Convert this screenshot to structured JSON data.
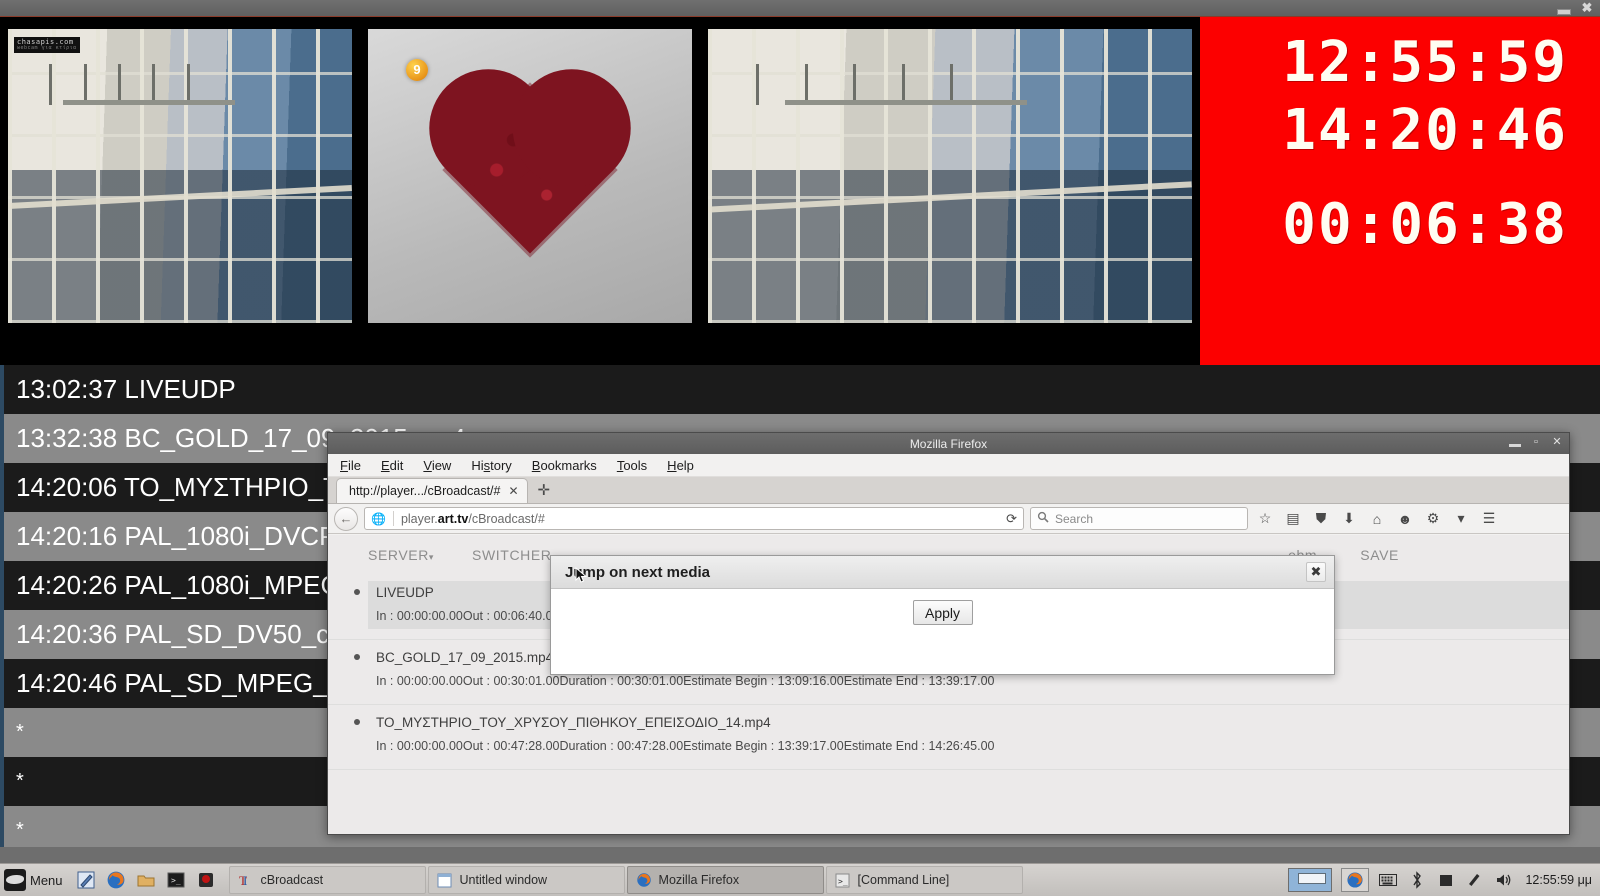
{
  "desktop": {
    "cbroadcast": {
      "window_title": "",
      "clock": {
        "line1": "12:55:59",
        "line2": "14:20:46",
        "line3": "00:06:38",
        "bg_color": "#fc0000",
        "digit_color": "#fffdf2"
      },
      "preview": {
        "left_watermark": "chasapis.com",
        "left_watermark_sub": "webcam για κτίρια",
        "mid_badge": "9"
      },
      "schedule_rows": [
        {
          "time": "13:02:37",
          "name": "LIVEUDP",
          "shade": "dark"
        },
        {
          "time": "13:32:38",
          "name": "BC_GOLD_17_09_2015.mp4",
          "shade": "light"
        },
        {
          "time": "14:20:06",
          "name": "ΤΟ_ΜΥΣΤΗΡΙΟ_ΤΟΥ_ΧΡΥΣΟΥ_ΠΙΘΗΚΟΥ_ΕΠΕΙΣΟΔΙΟ_14.mp4",
          "shade": "dark"
        },
        {
          "time": "14:20:16",
          "name": "PAL_1080i_DVCPRO_colorbars.mxf",
          "shade": "light"
        },
        {
          "time": "14:20:26",
          "name": "PAL_1080i_MPEG_XDCAM_colorbars.mxf",
          "shade": "dark"
        },
        {
          "time": "14:20:36",
          "name": "PAL_SD_DV50_colorbars.mxf",
          "shade": "light"
        },
        {
          "time": "14:20:46",
          "name": "PAL_SD_MPEG_IFrame_colorbars.mxf",
          "shade": "dark"
        },
        {
          "time": "",
          "name": "*",
          "shade": "light"
        },
        {
          "time": "",
          "name": "*",
          "shade": "dark"
        },
        {
          "time": "",
          "name": "*",
          "shade": "light"
        }
      ]
    },
    "firefox": {
      "title": "Mozilla Firefox",
      "menus": [
        "File",
        "Edit",
        "View",
        "History",
        "Bookmarks",
        "Tools",
        "Help"
      ],
      "tab": {
        "label": "http://player.../cBroadcast/#",
        "close": "✕"
      },
      "newtab_label": "✛",
      "url": {
        "prefix": "player.",
        "host": "art.tv",
        "path": "/cBroadcast/#"
      },
      "search_placeholder": "Search",
      "reload_icon": "⟳",
      "back_icon": "←",
      "toolbar_icons": [
        "star-icon",
        "library-icon",
        "pocket-icon",
        "download-icon",
        "home-icon",
        "hello-icon",
        "sync-icon",
        "menu-icon"
      ],
      "page": {
        "toolbar": {
          "server": "SERVER",
          "switcher": "SWITCHER",
          "format": "ebm",
          "save": "SAVE",
          "caret": "▾"
        },
        "playlist": [
          {
            "title": "LIVEUDP",
            "meta": "In : 00:00:00.00Out : 00:06:40.00Duration : 00:06:40.00Estimate Begin : 13:02:36.00Estimate End : 13:09:16.00",
            "selected": true
          },
          {
            "title": "BC_GOLD_17_09_2015.mp4",
            "meta": "In : 00:00:00.00Out : 00:30:01.00Duration : 00:30:01.00Estimate Begin : 13:09:16.00Estimate End : 13:39:17.00",
            "selected": false
          },
          {
            "title": "ΤΟ_ΜΥΣΤΗΡΙΟ_ΤΟΥ_ΧΡΥΣΟΥ_ΠΙΘΗΚΟΥ_ΕΠΕΙΣΟΔΙΟ_14.mp4",
            "meta": "In : 00:00:00.00Out : 00:47:28.00Duration : 00:47:28.00Estimate Begin : 13:39:17.00Estimate End : 14:26:45.00",
            "selected": false
          }
        ],
        "dialog": {
          "title": "Jump on next media",
          "close_label": "✖",
          "apply_label": "Apply"
        }
      }
    },
    "taskbar": {
      "menu_label": "Menu",
      "launchers": [
        "text-editor-icon",
        "firefox-icon",
        "file-manager-icon",
        "terminal-icon",
        "app-icon"
      ],
      "tasks": [
        {
          "label": "cBroadcast",
          "icon": "cbroadcast-icon",
          "active": false
        },
        {
          "label": "Untitled window",
          "icon": "window-icon",
          "active": false
        },
        {
          "label": "Mozilla Firefox",
          "icon": "firefox-icon",
          "active": true
        },
        {
          "label": "[Command Line]",
          "icon": "terminal-icon",
          "active": false
        }
      ],
      "tray_icons": [
        "keyboard-icon",
        "bluetooth-icon",
        "battery-icon",
        "brightness-icon",
        "volume-icon"
      ],
      "clock": "12:55:59 μμ"
    }
  }
}
